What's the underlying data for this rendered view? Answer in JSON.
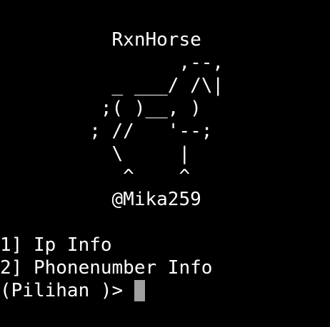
{
  "banner": {
    "title": "          RxnHorse",
    "art": [
      "                ,--,",
      "          _ ___/ /\\|",
      "         ;( )__, )",
      "        ; //   '--;",
      "          \\     |",
      "           ^    ^"
    ],
    "author": "          @Mika259"
  },
  "menu": {
    "items": [
      "1] Ip Info",
      "2] Phonenumber Info"
    ]
  },
  "prompt": {
    "text": "(Pilihan )> "
  },
  "colors": {
    "background": "#000000",
    "foreground": "#ffffff",
    "cursor": "#a0a0a0"
  }
}
